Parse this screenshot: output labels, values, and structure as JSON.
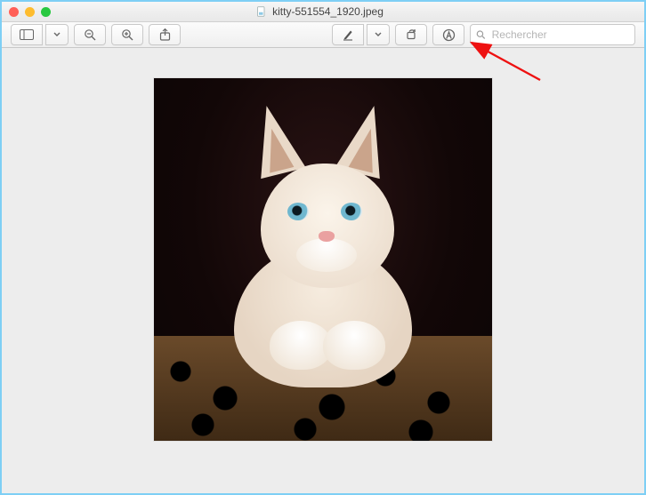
{
  "window": {
    "filename": "kitty-551554_1920.jpeg"
  },
  "toolbar": {
    "sidebar_button": "sidebar",
    "zoom_out": "−",
    "zoom_in": "+",
    "share": "share",
    "markup": "markup",
    "markup_menu": "▾",
    "rotate": "rotate",
    "edit_circle": "A"
  },
  "search": {
    "placeholder": "Rechercher"
  },
  "image": {
    "subject": "white kitten on leopard-print blanket"
  },
  "callout": {
    "target": "edit-button"
  }
}
